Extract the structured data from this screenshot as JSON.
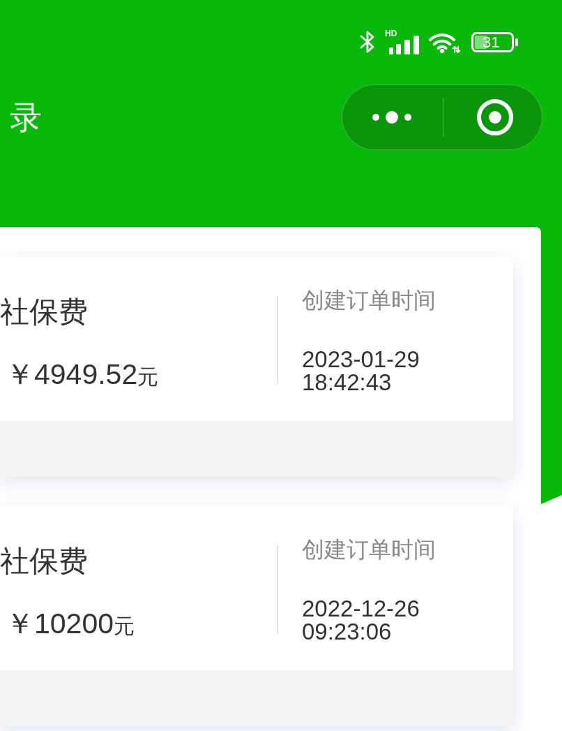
{
  "status_bar": {
    "network_label": "HD",
    "battery_text": "31"
  },
  "header": {
    "title": "录"
  },
  "orders": [
    {
      "name": "社保费",
      "amount": "￥4949.52",
      "unit": "元",
      "time_label": "创建订单时间",
      "created_at": "2023-01-29 18:42:43"
    },
    {
      "name": "社保费",
      "amount": "￥10200",
      "unit": "元",
      "time_label": "创建订单时间",
      "created_at": "2022-12-26 09:23:06"
    }
  ]
}
